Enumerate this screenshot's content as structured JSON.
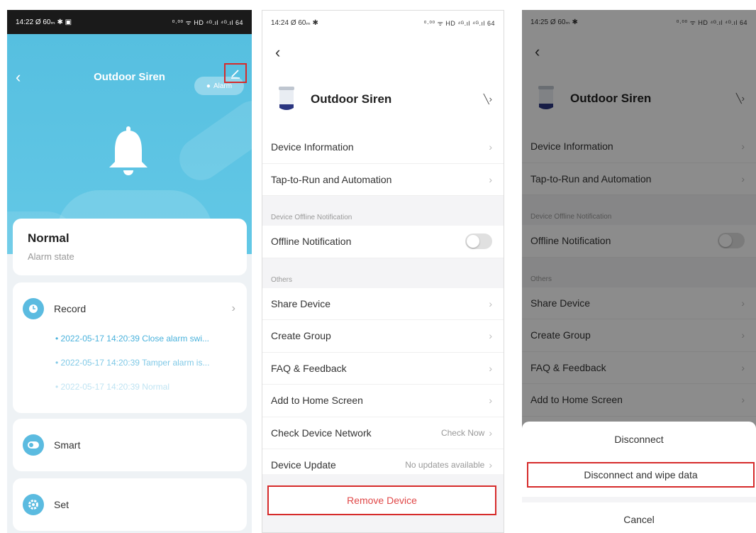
{
  "screen1": {
    "status": {
      "time": "14:22",
      "icons_left": "Ø 60ₘ ✱ ▣",
      "icons_right": "⁰·⁰⁰ ᯤ HD ⁴ᴳ.ıl ⁴ᴳ.ıl 64"
    },
    "title": "Outdoor Siren",
    "alarm_pill": "Alarm",
    "state_title": "Normal",
    "state_subtitle": "Alarm state",
    "record_label": "Record",
    "records": [
      "2022-05-17 14:20:39 Close alarm swi...",
      "2022-05-17 14:20:39 Tamper alarm is...",
      "2022-05-17 14:20:39 Normal"
    ],
    "smart_label": "Smart",
    "set_label": "Set"
  },
  "screen2": {
    "status": {
      "time": "14:24",
      "icons_left": "Ø 60ₘ ✱",
      "icons_right": "⁰·⁰⁰ ᯤ HD ⁴ᴳ.ıl ⁴ᴳ.ıl 64"
    },
    "device_name": "Outdoor Siren",
    "items_top": [
      "Device Information",
      "Tap-to-Run and Automation"
    ],
    "section_offline": "Device Offline Notification",
    "offline_notification": "Offline Notification",
    "section_others": "Others",
    "items_others": [
      "Share Device",
      "Create Group",
      "FAQ & Feedback",
      "Add to Home Screen"
    ],
    "check_network": {
      "label": "Check Device Network",
      "value": "Check Now"
    },
    "device_update": {
      "label": "Device Update",
      "value": "No updates available"
    },
    "remove_device": "Remove Device"
  },
  "screen3": {
    "status": {
      "time": "14:25",
      "icons_left": "Ø 60ₘ ✱",
      "icons_right": "⁰·⁰⁰ ᯤ HD ⁴ᴳ.ıl ⁴ᴳ.ıl 64"
    },
    "device_name": "Outdoor Siren",
    "items_top": [
      "Device Information",
      "Tap-to-Run and Automation"
    ],
    "section_offline": "Device Offline Notification",
    "offline_notification": "Offline Notification",
    "section_others": "Others",
    "items_others": [
      "Share Device",
      "Create Group",
      "FAQ & Feedback",
      "Add to Home Screen"
    ],
    "sheet": {
      "disconnect": "Disconnect",
      "disconnect_wipe": "Disconnect and wipe data",
      "cancel": "Cancel"
    }
  },
  "colors": {
    "accent": "#5bbbe0",
    "highlight": "#d62b2b",
    "danger_text": "#e04848"
  }
}
